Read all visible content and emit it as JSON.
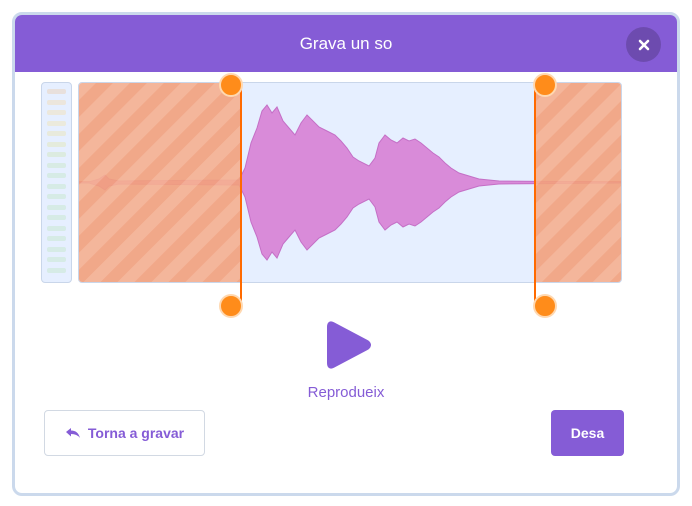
{
  "dialog": {
    "title": "Grava un so",
    "close_icon": "close-icon"
  },
  "colors": {
    "header": "#855cd6",
    "accent": "#855cd6",
    "trim_handle": "#ff8c1a",
    "trimmed_overlay": "#f2a07c",
    "waveform_fill": "#d98bd9",
    "waveform_muted": "#e5707f",
    "wave_background": "#e6efff"
  },
  "trim": {
    "start": 0.3,
    "end": 0.84
  },
  "playback": {
    "play_icon": "play-icon",
    "label": "Reprodueix"
  },
  "actions": {
    "rerecord_icon": "undo-icon",
    "rerecord_label": "Torna a gravar",
    "save_label": "Desa"
  }
}
